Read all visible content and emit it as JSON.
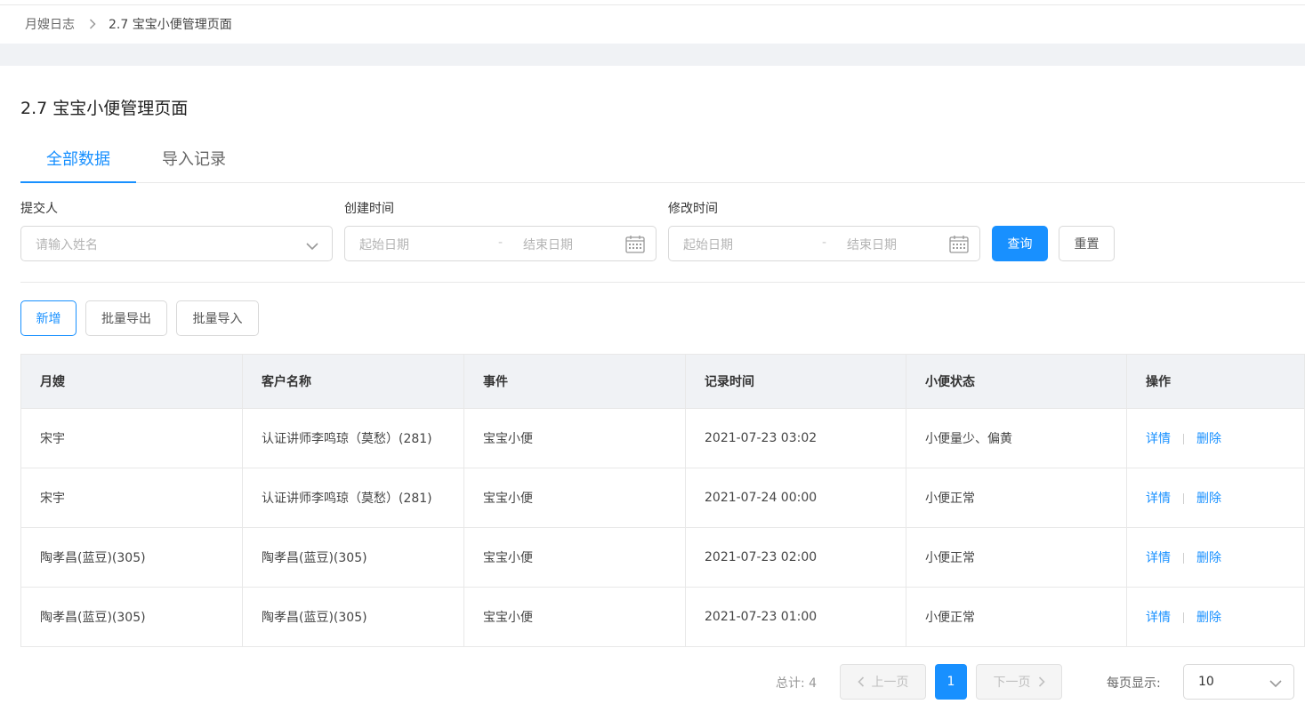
{
  "breadcrumb": {
    "parent": "月嫂日志",
    "current": "2.7 宝宝小便管理页面"
  },
  "page_title": "2.7 宝宝小便管理页面",
  "tabs": [
    {
      "label": "全部数据",
      "active": true
    },
    {
      "label": "导入记录",
      "active": false
    }
  ],
  "filters": {
    "submitter": {
      "label": "提交人",
      "placeholder": "请输入姓名"
    },
    "created": {
      "label": "创建时间",
      "start": "起始日期",
      "sep": "-",
      "end": "结束日期"
    },
    "modified": {
      "label": "修改时间",
      "start": "起始日期",
      "sep": "-",
      "end": "结束日期"
    },
    "query_button": "查询",
    "reset_button": "重置"
  },
  "actions": {
    "add": "新增",
    "export": "批量导出",
    "import": "批量导入"
  },
  "table": {
    "headers": [
      "月嫂",
      "客户名称",
      "事件",
      "记录时间",
      "小便状态",
      "操作"
    ],
    "rows": [
      [
        "宋宇",
        "认证讲师李鸣琼（莫愁）(281)",
        "宝宝小便",
        "2021-07-23 03:02",
        "小便量少、偏黄"
      ],
      [
        "宋宇",
        "认证讲师李鸣琼（莫愁）(281)",
        "宝宝小便",
        "2021-07-24 00:00",
        "小便正常"
      ],
      [
        "陶孝昌(蓝豆)(305)",
        "陶孝昌(蓝豆)(305)",
        "宝宝小便",
        "2021-07-23 02:00",
        "小便正常"
      ],
      [
        "陶孝昌(蓝豆)(305)",
        "陶孝昌(蓝豆)(305)",
        "宝宝小便",
        "2021-07-23 01:00",
        "小便正常"
      ]
    ],
    "op_detail": "详情",
    "op_delete": "删除"
  },
  "pagination": {
    "total": "总计: 4",
    "prev": "上一页",
    "current_page": "1",
    "next": "下一页",
    "per_page_label": "每页显示:",
    "per_page_value": "10"
  },
  "colors": {
    "primary": "#1890ff",
    "header_bg": "#f0f2f5",
    "border": "#e8e8e8"
  }
}
